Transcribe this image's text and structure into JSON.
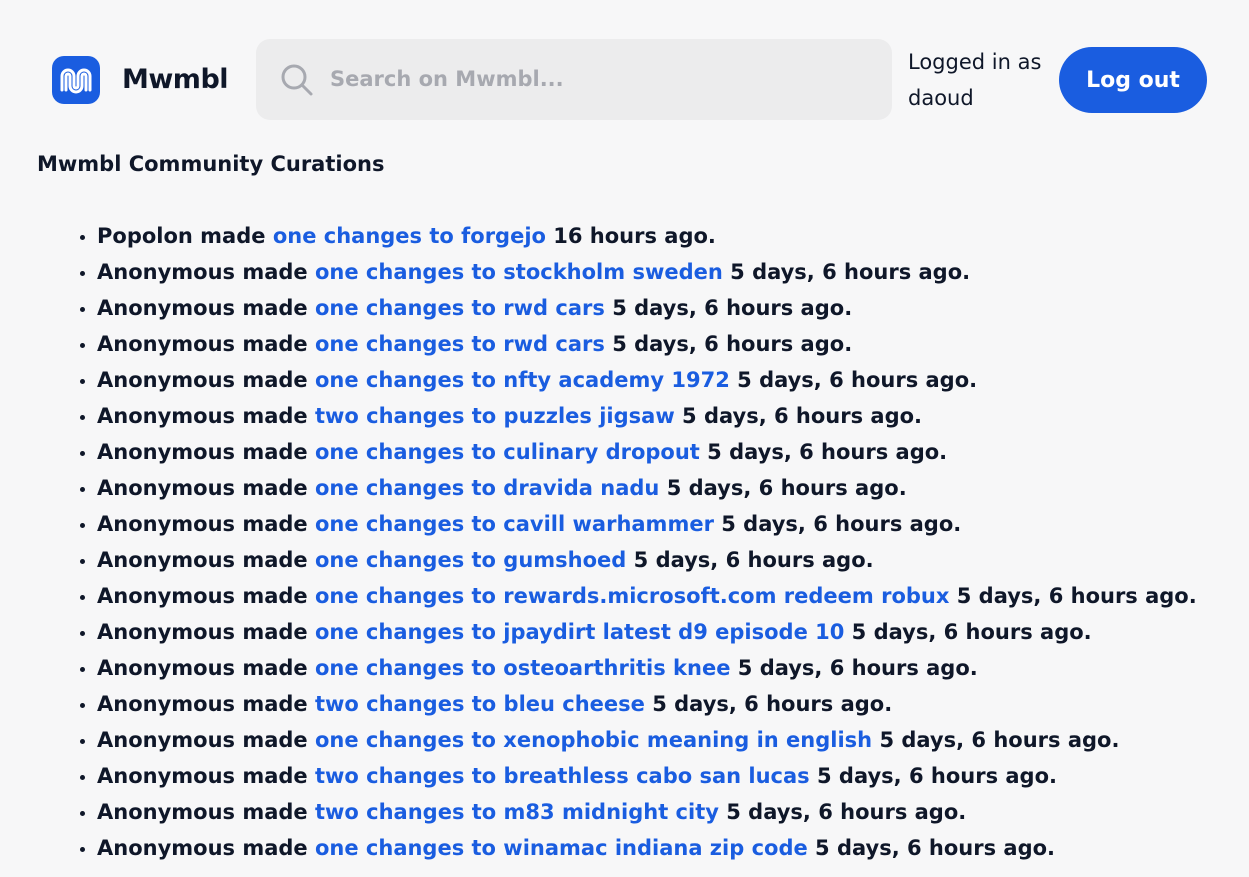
{
  "header": {
    "brand": "Mwmbl",
    "search_placeholder": "Search on Mwmbl...",
    "logged_in_text": "Logged in as daoud",
    "logout_label": "Log out"
  },
  "section_title": "Mwmbl Community Curations",
  "curations": [
    {
      "user": "Popolon",
      "made": "made",
      "link": "one changes to forgejo",
      "time": "16 hours ago."
    },
    {
      "user": "Anonymous",
      "made": "made",
      "link": "one changes to stockholm sweden",
      "time": "5 days, 6 hours ago."
    },
    {
      "user": "Anonymous",
      "made": "made",
      "link": "one changes to rwd cars",
      "time": "5 days, 6 hours ago."
    },
    {
      "user": "Anonymous",
      "made": "made",
      "link": "one changes to rwd cars",
      "time": "5 days, 6 hours ago."
    },
    {
      "user": "Anonymous",
      "made": "made",
      "link": "one changes to nfty academy 1972",
      "time": "5 days, 6 hours ago."
    },
    {
      "user": "Anonymous",
      "made": "made",
      "link": "two changes to puzzles jigsaw",
      "time": "5 days, 6 hours ago."
    },
    {
      "user": "Anonymous",
      "made": "made",
      "link": "one changes to culinary dropout",
      "time": "5 days, 6 hours ago."
    },
    {
      "user": "Anonymous",
      "made": "made",
      "link": "one changes to dravida nadu",
      "time": "5 days, 6 hours ago."
    },
    {
      "user": "Anonymous",
      "made": "made",
      "link": "one changes to cavill warhammer",
      "time": "5 days, 6 hours ago."
    },
    {
      "user": "Anonymous",
      "made": "made",
      "link": "one changes to gumshoed",
      "time": "5 days, 6 hours ago."
    },
    {
      "user": "Anonymous",
      "made": "made",
      "link": "one changes to rewards.microsoft.com redeem robux",
      "time": "5 days, 6 hours ago."
    },
    {
      "user": "Anonymous",
      "made": "made",
      "link": "one changes to jpaydirt latest d9 episode 10",
      "time": "5 days, 6 hours ago."
    },
    {
      "user": "Anonymous",
      "made": "made",
      "link": "one changes to osteoarthritis knee",
      "time": "5 days, 6 hours ago."
    },
    {
      "user": "Anonymous",
      "made": "made",
      "link": "two changes to bleu cheese",
      "time": "5 days, 6 hours ago."
    },
    {
      "user": "Anonymous",
      "made": "made",
      "link": "one changes to xenophobic meaning in english",
      "time": "5 days, 6 hours ago."
    },
    {
      "user": "Anonymous",
      "made": "made",
      "link": "two changes to breathless cabo san lucas",
      "time": "5 days, 6 hours ago."
    },
    {
      "user": "Anonymous",
      "made": "made",
      "link": "two changes to m83 midnight city",
      "time": "5 days, 6 hours ago."
    },
    {
      "user": "Anonymous",
      "made": "made",
      "link": "one changes to winamac indiana zip code",
      "time": "5 days, 6 hours ago."
    }
  ],
  "colors": {
    "accent": "#1a5de0",
    "text": "#0f1729",
    "background": "#f7f7f8",
    "search_bg": "#ececed"
  },
  "icons": {
    "logo": "mwmbl-logo-icon",
    "search": "search-icon"
  }
}
